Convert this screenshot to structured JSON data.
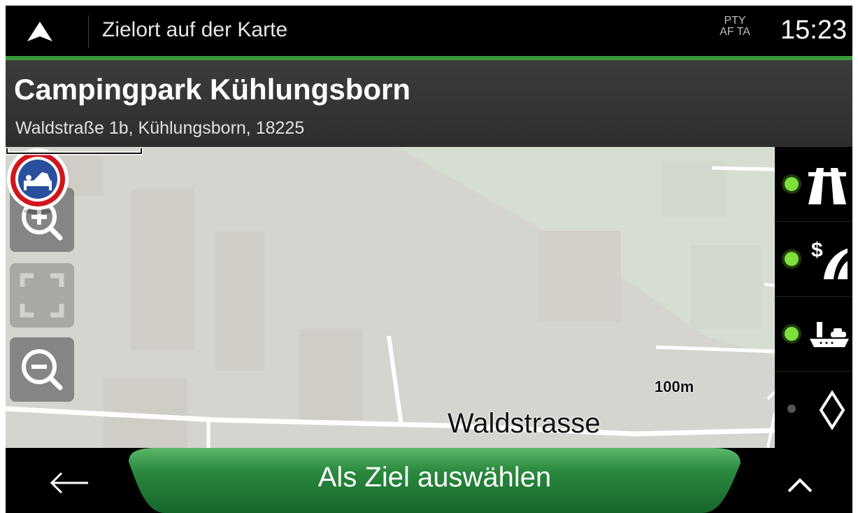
{
  "topbar": {
    "title": "Zielort auf der Karte",
    "radio_line1": "PTY",
    "radio_line2": "AF TA",
    "clock": "15:23"
  },
  "place": {
    "name": "Campingpark Kühlungsborn",
    "address": "Waldstraße 1b, Kühlungsborn, 18225"
  },
  "map": {
    "road_label": "Waldstrasse",
    "scale_label": "100m",
    "poi_icon": "bed-icon",
    "zoom_in_icon": "zoom-in-icon",
    "fit_icon": "fit-view-icon",
    "zoom_out_icon": "zoom-out-icon"
  },
  "route_options": [
    {
      "icon": "motorway-icon",
      "enabled": true
    },
    {
      "icon": "toll-road-icon",
      "enabled": true
    },
    {
      "icon": "ferry-icon",
      "enabled": true
    },
    {
      "icon": "unpaved-road-icon",
      "enabled": false
    }
  ],
  "bottombar": {
    "back_icon": "back-arrow-icon",
    "action_label": "Als Ziel auswählen",
    "more_icon": "chevron-up-icon"
  },
  "colors": {
    "accent_green": "#3a9a3a",
    "button_green": "#1e7a35",
    "indicator_on": "#7ee03a",
    "indicator_off": "#555555",
    "poi_ring": "#d0161c",
    "poi_fill": "#2a4f9e"
  }
}
